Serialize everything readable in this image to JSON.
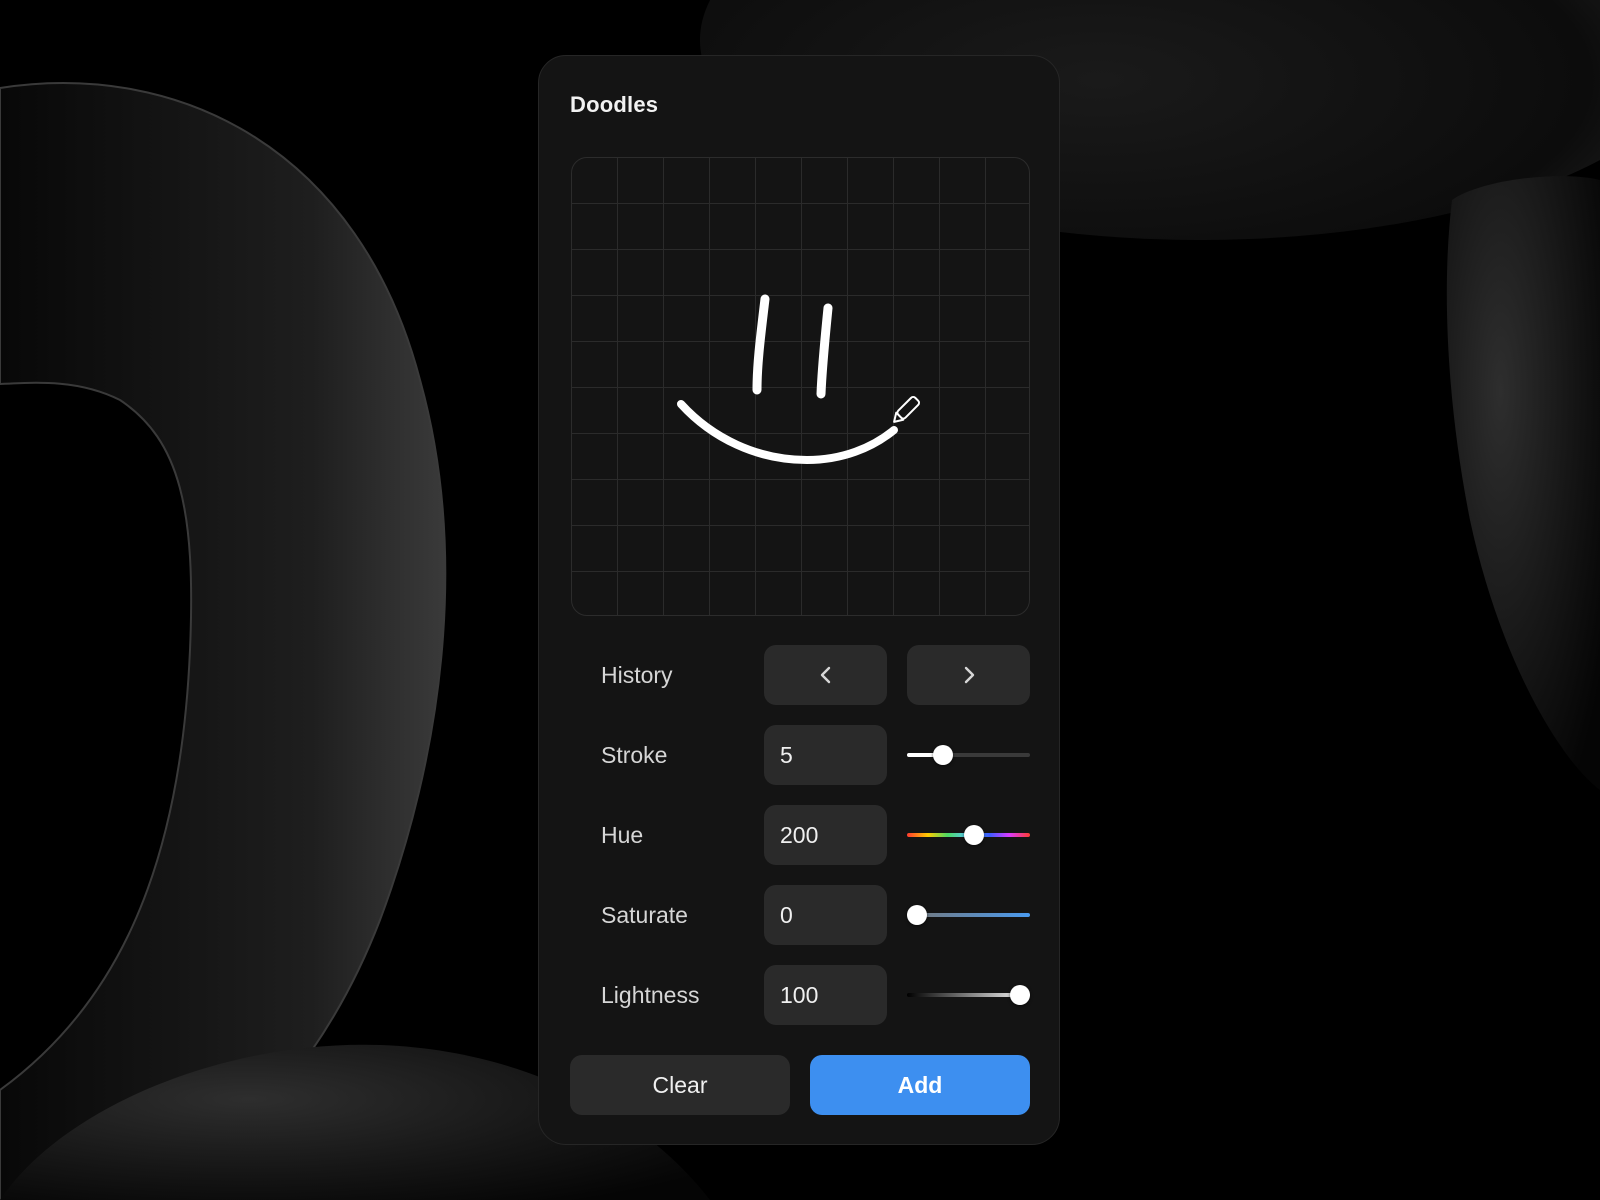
{
  "panel": {
    "title": "Doodles"
  },
  "controls": {
    "history": {
      "label": "History",
      "prev_icon": "chevron-left-icon",
      "next_icon": "chevron-right-icon"
    },
    "stroke": {
      "label": "Stroke",
      "value": "5",
      "slider_level": 0.25
    },
    "hue": {
      "label": "Hue",
      "value": "200",
      "slider_level": 0.55
    },
    "saturate": {
      "label": "Saturate",
      "value": "0",
      "slider_level": 0.0
    },
    "lightness": {
      "label": "Lightness",
      "value": "100",
      "slider_level": 1.0
    }
  },
  "actions": {
    "clear_label": "Clear",
    "add_label": "Add"
  },
  "colors": {
    "accent": "#3d8ff0",
    "panel_bg": "#141414",
    "control_bg": "#2a2a2a",
    "stroke_color": "#ffffff"
  },
  "canvas": {
    "cursor_icon": "pen-icon"
  }
}
